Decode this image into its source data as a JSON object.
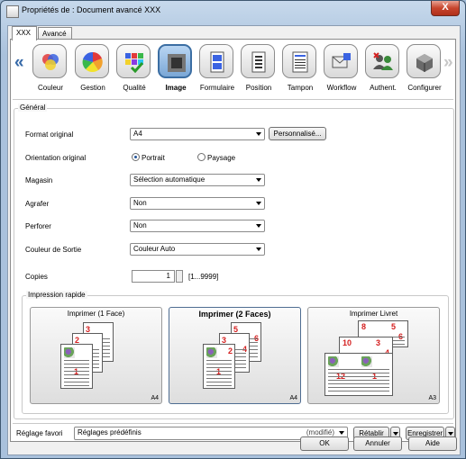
{
  "window": {
    "title": "Propriétés de : Document avancé XXX",
    "close_glyph": "X"
  },
  "tabs": [
    {
      "label": "XXX"
    },
    {
      "label": "Avancé"
    }
  ],
  "categories": [
    {
      "label": "Couleur",
      "icon": "color-circles-icon"
    },
    {
      "label": "Gestion",
      "icon": "color-wheel-icon"
    },
    {
      "label": "Qualité",
      "icon": "quality-grid-icon"
    },
    {
      "label": "Image",
      "icon": "image-halftone-icon"
    },
    {
      "label": "Formulaire",
      "icon": "form-ab-icon"
    },
    {
      "label": "Position",
      "icon": "position-page-icon"
    },
    {
      "label": "Tampon",
      "icon": "stamp-page-icon"
    },
    {
      "label": "Workflow",
      "icon": "workflow-envelope-icon"
    },
    {
      "label": "Authent.",
      "icon": "authentication-users-icon"
    },
    {
      "label": "Configurer",
      "icon": "configure-cube-icon"
    }
  ],
  "arrows": {
    "left": "«",
    "right": "»"
  },
  "general": {
    "title": "Général",
    "format": {
      "label": "Format original",
      "value": "A4",
      "button": "Personnalisé..."
    },
    "orientation": {
      "label": "Orientation original",
      "options": [
        "Portrait",
        "Paysage"
      ],
      "selected": "Portrait"
    },
    "magasin": {
      "label": "Magasin",
      "value": "Sélection automatique"
    },
    "agrafer": {
      "label": "Agrafer",
      "value": "Non"
    },
    "perforer": {
      "label": "Perforer",
      "value": "Non"
    },
    "couleur": {
      "label": "Couleur de Sortie",
      "value": "Couleur Auto"
    },
    "copies": {
      "label": "Copies",
      "value": "1",
      "range": "[1...9999]"
    },
    "quick_print": {
      "title": "Impression rapide",
      "cards": [
        {
          "title": "Imprimer (1 Face)",
          "size": "A4",
          "pages": [
            "3",
            "2",
            "1"
          ]
        },
        {
          "title": "Imprimer (2 Faces)",
          "size": "A4",
          "pages": [
            "5",
            "6",
            "3",
            "4",
            "1",
            "2"
          ]
        },
        {
          "title": "Imprimer Livret",
          "size": "A3",
          "pages": [
            "8",
            "5",
            "6",
            "10",
            "3",
            "4",
            "12",
            "1"
          ]
        }
      ]
    }
  },
  "favorites": {
    "label": "Réglage favori",
    "value": "Réglages prédéfinis",
    "status": "(modifié)",
    "restore": "Rétablir",
    "save": "Enregistrer"
  },
  "footer": {
    "ok": "OK",
    "cancel": "Annuler",
    "help": "Aide"
  },
  "colors": {
    "title_bar": "#a9c1dc",
    "accent": "#3b6ea3",
    "page_number": "#d41f1f"
  }
}
